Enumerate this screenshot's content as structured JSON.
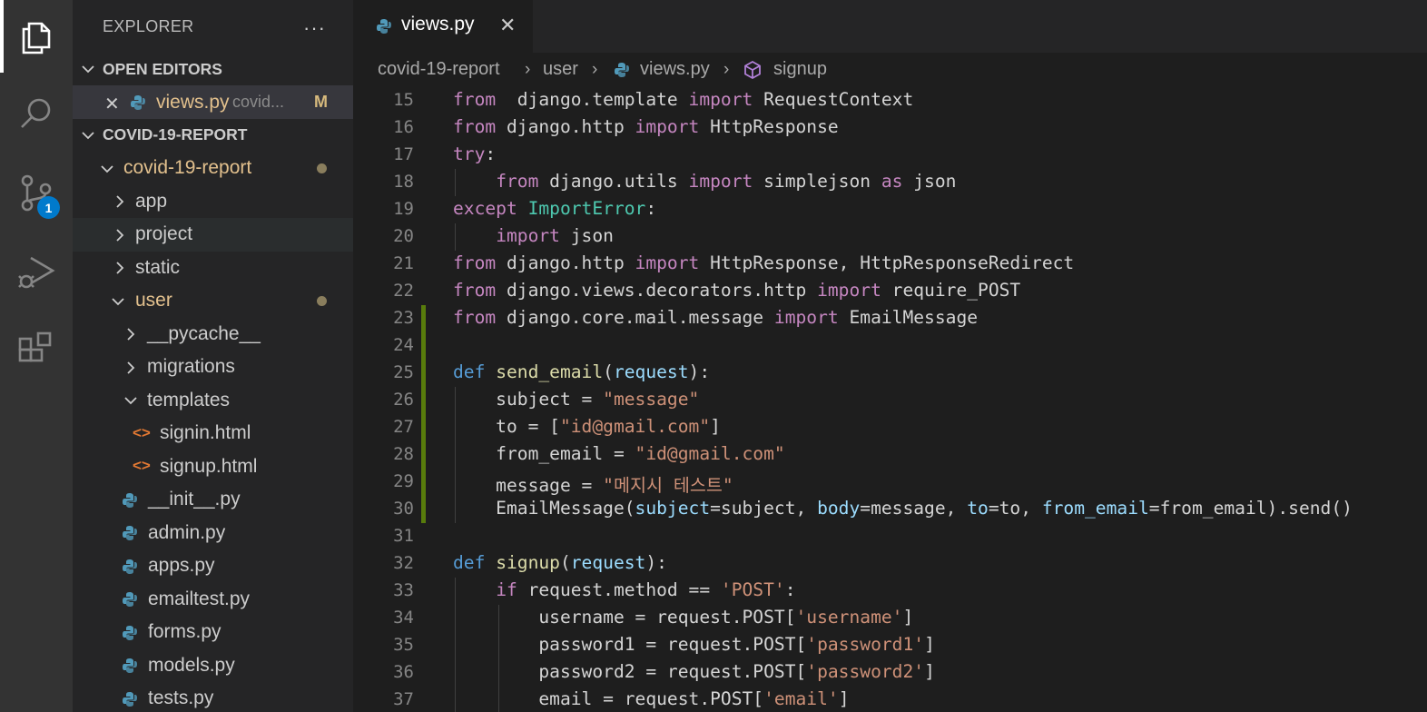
{
  "activity_bar": {
    "items": [
      {
        "name": "explorer",
        "icon": "files-icon"
      },
      {
        "name": "search",
        "icon": "search-icon"
      },
      {
        "name": "source-control",
        "icon": "source-control-icon",
        "badge": "1"
      },
      {
        "name": "run-debug",
        "icon": "run-debug-icon"
      },
      {
        "name": "extensions",
        "icon": "extensions-icon"
      }
    ]
  },
  "sidebar": {
    "title": "EXPLORER",
    "more": "···",
    "open_editors": {
      "label": "OPEN EDITORS",
      "files": [
        {
          "name": "views.py",
          "desc": "covid...",
          "status": "M"
        }
      ]
    },
    "project": {
      "label": "COVID-19-REPORT",
      "tree": [
        {
          "label": "covid-19-report",
          "type": "folder-open",
          "modified": true
        },
        {
          "label": "app",
          "type": "folder"
        },
        {
          "label": "project",
          "type": "folder"
        },
        {
          "label": "static",
          "type": "folder"
        },
        {
          "label": "user",
          "type": "folder-open",
          "modified": true
        },
        {
          "label": "__pycache__",
          "type": "folder"
        },
        {
          "label": "migrations",
          "type": "folder"
        },
        {
          "label": "templates",
          "type": "folder-open"
        },
        {
          "label": "signin.html",
          "type": "html"
        },
        {
          "label": "signup.html",
          "type": "html"
        },
        {
          "label": "__init__.py",
          "type": "py"
        },
        {
          "label": "admin.py",
          "type": "py"
        },
        {
          "label": "apps.py",
          "type": "py"
        },
        {
          "label": "emailtest.py",
          "type": "py"
        },
        {
          "label": "forms.py",
          "type": "py"
        },
        {
          "label": "models.py",
          "type": "py"
        },
        {
          "label": "tests.py",
          "type": "py"
        }
      ]
    }
  },
  "tab": {
    "label": "views.py",
    "close": "✕"
  },
  "breadcrumb": {
    "items": [
      "covid-19-report",
      "user",
      "views.py",
      "signup"
    ],
    "separator": "›"
  },
  "editor": {
    "lines": [
      {
        "n": "15",
        "tokens": [
          [
            "kw",
            "from"
          ],
          [
            "",
            "  django.template "
          ],
          [
            "kw",
            "import"
          ],
          [
            "",
            " RequestContext"
          ]
        ]
      },
      {
        "n": "16",
        "tokens": [
          [
            "kw",
            "from"
          ],
          [
            "",
            " django.http "
          ],
          [
            "kw",
            "import"
          ],
          [
            "",
            " HttpResponse"
          ]
        ]
      },
      {
        "n": "17",
        "tokens": [
          [
            "kw",
            "try"
          ],
          [
            "",
            ":"
          ]
        ]
      },
      {
        "n": "18",
        "tokens": [
          [
            "",
            "    "
          ],
          [
            "kw",
            "from"
          ],
          [
            "",
            " django.utils "
          ],
          [
            "kw",
            "import"
          ],
          [
            "",
            " simplejson "
          ],
          [
            "kw",
            "as"
          ],
          [
            "",
            " json"
          ]
        ]
      },
      {
        "n": "19",
        "tokens": [
          [
            "kw",
            "except"
          ],
          [
            "",
            " "
          ],
          [
            "cls",
            "ImportError"
          ],
          [
            "",
            ":"
          ]
        ]
      },
      {
        "n": "20",
        "tokens": [
          [
            "",
            "    "
          ],
          [
            "kw",
            "import"
          ],
          [
            "",
            " json"
          ]
        ]
      },
      {
        "n": "21",
        "tokens": [
          [
            "kw",
            "from"
          ],
          [
            "",
            " django.http "
          ],
          [
            "kw",
            "import"
          ],
          [
            "",
            " HttpResponse, HttpResponseRedirect"
          ]
        ]
      },
      {
        "n": "22",
        "tokens": [
          [
            "kw",
            "from"
          ],
          [
            "",
            " django.views.decorators.http "
          ],
          [
            "kw",
            "import"
          ],
          [
            "",
            " require_POST"
          ]
        ]
      },
      {
        "n": "23",
        "tokens": [
          [
            "kw",
            "from"
          ],
          [
            "",
            " django.core.mail.message "
          ],
          [
            "kw",
            "import"
          ],
          [
            "",
            " EmailMessage"
          ]
        ]
      },
      {
        "n": "24",
        "tokens": []
      },
      {
        "n": "25",
        "tokens": [
          [
            "def",
            "def"
          ],
          [
            "",
            " "
          ],
          [
            "fn",
            "send_email"
          ],
          [
            "",
            "("
          ],
          [
            "prm",
            "request"
          ],
          [
            "",
            "):"
          ]
        ]
      },
      {
        "n": "26",
        "tokens": [
          [
            "",
            "    subject = "
          ],
          [
            "str",
            "\"message\""
          ]
        ]
      },
      {
        "n": "27",
        "tokens": [
          [
            "",
            "    to = ["
          ],
          [
            "str",
            "\"id@gmail.com\""
          ],
          [
            "",
            "]"
          ]
        ]
      },
      {
        "n": "28",
        "tokens": [
          [
            "",
            "    from_email = "
          ],
          [
            "str",
            "\"id@gmail.com\""
          ]
        ]
      },
      {
        "n": "29",
        "tokens": [
          [
            "",
            "    message = "
          ],
          [
            "str",
            "\"메지시 테스트\""
          ]
        ]
      },
      {
        "n": "30",
        "tokens": [
          [
            "",
            "    EmailMessage("
          ],
          [
            "prm",
            "subject"
          ],
          [
            "",
            "=subject, "
          ],
          [
            "prm",
            "body"
          ],
          [
            "",
            "=message, "
          ],
          [
            "prm",
            "to"
          ],
          [
            "",
            "=to, "
          ],
          [
            "prm",
            "from_email"
          ],
          [
            "",
            "=from_email).send()"
          ]
        ]
      },
      {
        "n": "31",
        "tokens": []
      },
      {
        "n": "32",
        "tokens": [
          [
            "def",
            "def"
          ],
          [
            "",
            " "
          ],
          [
            "fn",
            "signup"
          ],
          [
            "",
            "("
          ],
          [
            "prm",
            "request"
          ],
          [
            "",
            "):"
          ]
        ]
      },
      {
        "n": "33",
        "tokens": [
          [
            "",
            "    "
          ],
          [
            "kw",
            "if"
          ],
          [
            "",
            " request.method == "
          ],
          [
            "str",
            "'POST'"
          ],
          [
            "",
            ":"
          ]
        ]
      },
      {
        "n": "34",
        "tokens": [
          [
            "",
            "        username = request.POST["
          ],
          [
            "str",
            "'username'"
          ],
          [
            "",
            "]"
          ]
        ]
      },
      {
        "n": "35",
        "tokens": [
          [
            "",
            "        password1 = request.POST["
          ],
          [
            "str",
            "'password1'"
          ],
          [
            "",
            "]"
          ]
        ]
      },
      {
        "n": "36",
        "tokens": [
          [
            "",
            "        password2 = request.POST["
          ],
          [
            "str",
            "'password2'"
          ],
          [
            "",
            "]"
          ]
        ]
      },
      {
        "n": "37",
        "tokens": [
          [
            "",
            "        email = request.POST["
          ],
          [
            "str",
            "'email'"
          ],
          [
            "",
            "]"
          ]
        ]
      }
    ],
    "modified_lines": [
      "23",
      "24",
      "25",
      "26",
      "27",
      "28",
      "29",
      "30"
    ]
  }
}
